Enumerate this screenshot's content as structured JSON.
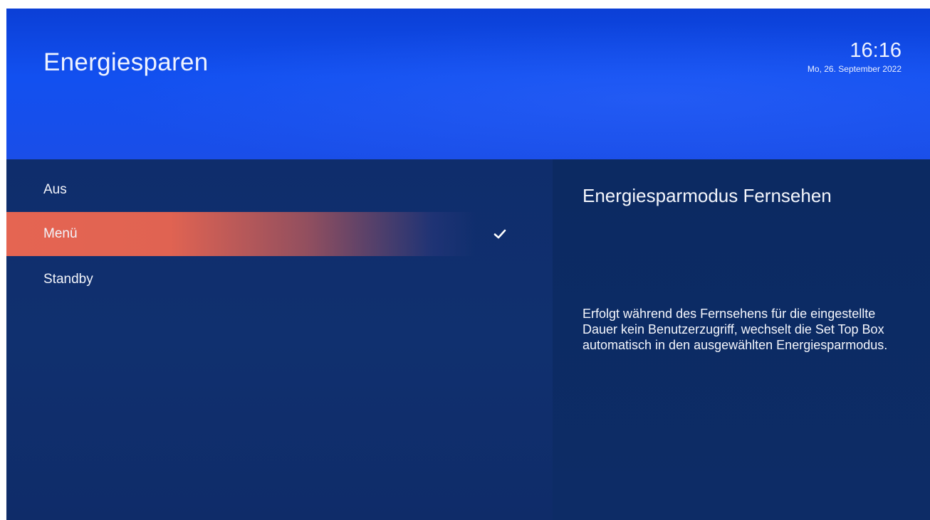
{
  "header": {
    "title": "Energiesparen",
    "time": "16:16",
    "date": "Mo, 26. September 2022"
  },
  "menu": {
    "items": [
      {
        "label": "Aus",
        "selected": false
      },
      {
        "label": "Menü",
        "selected": true
      },
      {
        "label": "Standby",
        "selected": false
      }
    ],
    "check_icon": "checkmark-icon"
  },
  "detail": {
    "title": "Energiesparmodus Fernsehen",
    "description": "Erfolgt während des Fernsehens für die eingestellte Dauer kein Benutzerzugriff, wechselt die Set Top Box automatisch in den ausgewählten Energiesparmodus."
  },
  "colors": {
    "header_blue": "#1250f0",
    "panel_navy": "#0f2d6c",
    "highlight": "#e56552",
    "text": "#ffffff"
  }
}
